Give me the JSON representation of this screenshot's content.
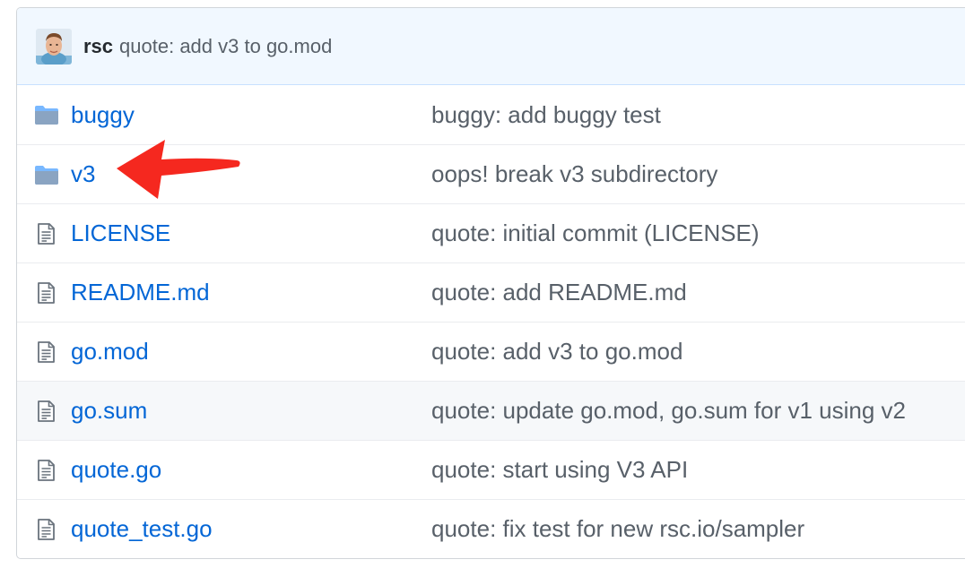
{
  "commit": {
    "author": "rsc",
    "message": "quote: add v3 to go.mod"
  },
  "rows": [
    {
      "type": "dir",
      "icon": "folder-icon",
      "name": "buggy",
      "message": "buggy: add buggy test"
    },
    {
      "type": "dir",
      "icon": "folder-icon",
      "name": "v3",
      "message": "oops! break v3 subdirectory"
    },
    {
      "type": "file",
      "icon": "file-icon",
      "name": "LICENSE",
      "message": "quote: initial commit (LICENSE)"
    },
    {
      "type": "file",
      "icon": "file-icon",
      "name": "README.md",
      "message": "quote: add README.md"
    },
    {
      "type": "file",
      "icon": "file-icon",
      "name": "go.mod",
      "message": "quote: add v3 to go.mod"
    },
    {
      "type": "file",
      "icon": "file-icon",
      "name": "go.sum",
      "message": "quote: update go.mod, go.sum for v1 using v2"
    },
    {
      "type": "file",
      "icon": "file-icon",
      "name": "quote.go",
      "message": "quote: start using V3 API"
    },
    {
      "type": "file",
      "icon": "file-icon",
      "name": "quote_test.go",
      "message": "quote: fix test for new rsc.io/sampler"
    }
  ],
  "colors": {
    "link": "#0366d6",
    "muted": "#586069",
    "folder": "#79b8ff",
    "annotation_arrow": "#f5281f"
  }
}
